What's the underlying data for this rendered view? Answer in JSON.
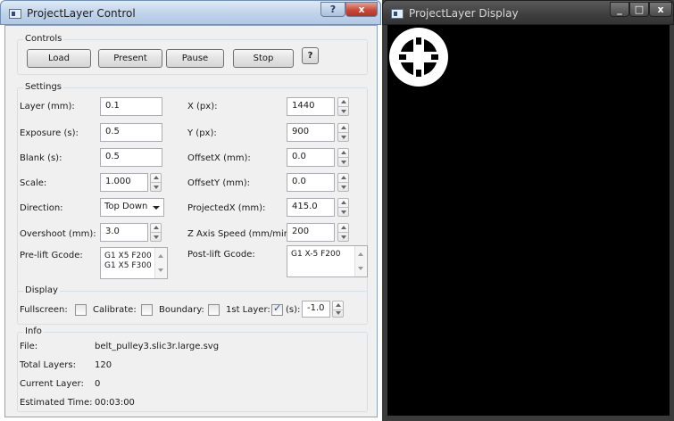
{
  "control_window": {
    "title": "ProjectLayer Control",
    "help_glyph": "?",
    "close_glyph": "x"
  },
  "display_window": {
    "title": "ProjectLayer Display",
    "min_glyph": "_",
    "max_glyph": "□",
    "close_glyph": "x"
  },
  "controls": {
    "title": "Controls",
    "load": "Load",
    "present": "Present",
    "pause": "Pause",
    "stop": "Stop",
    "help": "?"
  },
  "settings": {
    "title": "Settings",
    "layer_label": "Layer (mm):",
    "layer_value": "0.1",
    "exposure_label": "Exposure (s):",
    "exposure_value": "0.5",
    "blank_label": "Blank (s):",
    "blank_value": "0.5",
    "scale_label": "Scale:",
    "scale_value": "1.000",
    "direction_label": "Direction:",
    "direction_value": "Top Down",
    "overshoot_label": "Overshoot (mm):",
    "overshoot_value": "3.0",
    "prelift_label": "Pre-lift Gcode:",
    "prelift_line1": "G1 X5 F200",
    "prelift_line2": "G1 X5 F300",
    "x_label": "X (px):",
    "x_value": "1440",
    "y_label": "Y (px):",
    "y_value": "900",
    "offsetx_label": "OffsetX (mm):",
    "offsetx_value": "0.0",
    "offsety_label": "OffsetY (mm):",
    "offsety_value": "0.0",
    "projectedx_label": "ProjectedX (mm):",
    "projectedx_value": "415.0",
    "zspeed_label": "Z Axis Speed (mm/min):",
    "zspeed_value": "200",
    "postlift_label": "Post-lift Gcode:",
    "postlift_value": "G1 X-5 F200"
  },
  "display": {
    "title": "Display",
    "fullscreen_label": "Fullscreen:",
    "calibrate_label": "Calibrate:",
    "boundary_label": "Boundary:",
    "first_layer_label": "1st Layer:",
    "seconds_label": "(s):",
    "seconds_value": "-1.0",
    "fullscreen_checked": false,
    "calibrate_checked": false,
    "boundary_checked": false,
    "first_layer_checked": true
  },
  "info": {
    "title": "Info",
    "file_label": "File:",
    "file_value": "belt_pulley3.slic3r.large.svg",
    "total_label": "Total Layers:",
    "total_value": "120",
    "current_label": "Current Layer:",
    "current_value": "0",
    "time_label": "Estimated Time:",
    "time_value": "00:03:00"
  },
  "colors": {
    "display_background": "#000000",
    "close_button": "#c94a3a",
    "titlebar": "#bdd1e9"
  }
}
